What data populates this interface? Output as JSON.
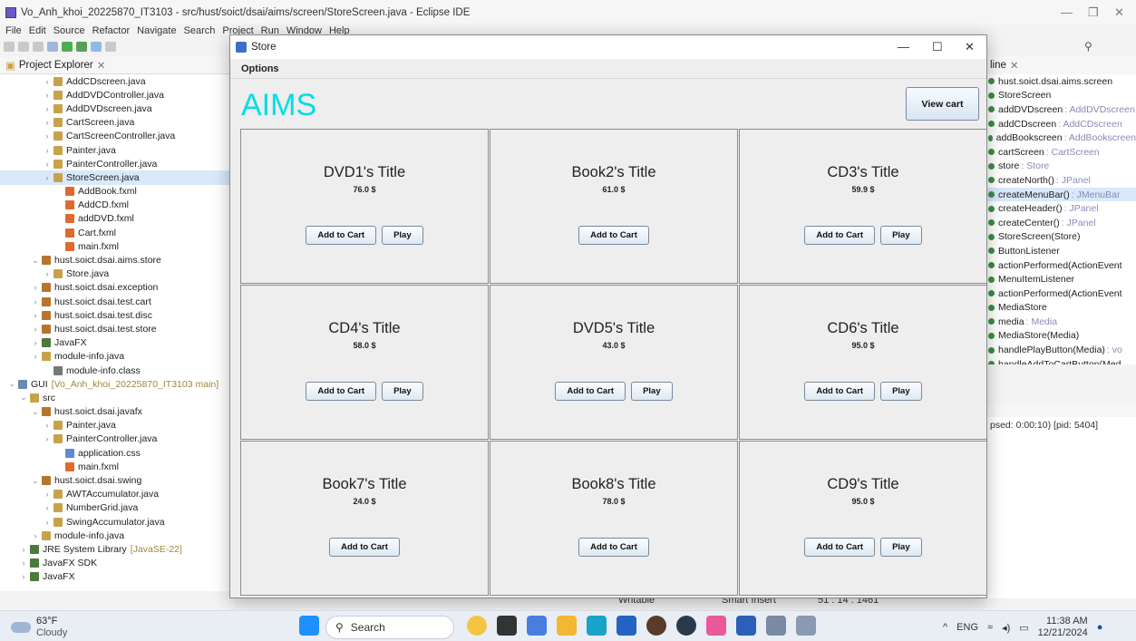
{
  "eclipse": {
    "title": "Vo_Anh_khoi_20225870_IT3103 - src/hust/soict/dsai/aims/screen/StoreScreen.java - Eclipse IDE",
    "menus": [
      "File",
      "Edit",
      "Source",
      "Refactor",
      "Navigate",
      "Search",
      "Project",
      "Run",
      "Window",
      "Help"
    ],
    "project_explorer_title": "Project Explorer",
    "tree": [
      {
        "label": "AddCDscreen.java",
        "indent": 3,
        "kind": "java"
      },
      {
        "label": "AddDVDController.java",
        "indent": 3,
        "kind": "java"
      },
      {
        "label": "AddDVDscreen.java",
        "indent": 3,
        "kind": "java"
      },
      {
        "label": "CartScreen.java",
        "indent": 3,
        "kind": "java"
      },
      {
        "label": "CartScreenController.java",
        "indent": 3,
        "kind": "java"
      },
      {
        "label": "Painter.java",
        "indent": 3,
        "kind": "java"
      },
      {
        "label": "PainterController.java",
        "indent": 3,
        "kind": "java"
      },
      {
        "label": "StoreScreen.java",
        "indent": 3,
        "kind": "java",
        "selected": true
      },
      {
        "label": "AddBook.fxml",
        "indent": 4,
        "kind": "fxml"
      },
      {
        "label": "AddCD.fxml",
        "indent": 4,
        "kind": "fxml"
      },
      {
        "label": "addDVD.fxml",
        "indent": 4,
        "kind": "fxml"
      },
      {
        "label": "Cart.fxml",
        "indent": 4,
        "kind": "fxml"
      },
      {
        "label": "main.fxml",
        "indent": 4,
        "kind": "fxml"
      },
      {
        "label": "hust.soict.dsai.aims.store",
        "indent": 2,
        "kind": "pkg",
        "open": true
      },
      {
        "label": "Store.java",
        "indent": 3,
        "kind": "java"
      },
      {
        "label": "hust.soict.dsai.exception",
        "indent": 2,
        "kind": "pkg"
      },
      {
        "label": "hust.soict.dsai.test.cart",
        "indent": 2,
        "kind": "pkg"
      },
      {
        "label": "hust.soict.dsai.test.disc",
        "indent": 2,
        "kind": "pkg"
      },
      {
        "label": "hust.soict.dsai.test.store",
        "indent": 2,
        "kind": "pkg"
      },
      {
        "label": "JavaFX",
        "indent": 2,
        "kind": "lib"
      },
      {
        "label": "module-info.java",
        "indent": 2,
        "kind": "java"
      },
      {
        "label": "module-info.class",
        "indent": 3,
        "kind": "class"
      },
      {
        "label": "GUI",
        "deco": "[Vo_Anh_khoi_20225870_IT3103 main]",
        "indent": 0,
        "kind": "project",
        "open": true
      },
      {
        "label": "src",
        "indent": 1,
        "kind": "src",
        "open": true
      },
      {
        "label": "hust.soict.dsai.javafx",
        "indent": 2,
        "kind": "pkg",
        "open": true
      },
      {
        "label": "Painter.java",
        "indent": 3,
        "kind": "java"
      },
      {
        "label": "PainterController.java",
        "indent": 3,
        "kind": "java"
      },
      {
        "label": "application.css",
        "indent": 4,
        "kind": "css"
      },
      {
        "label": "main.fxml",
        "indent": 4,
        "kind": "fxml"
      },
      {
        "label": "hust.soict.dsai.swing",
        "indent": 2,
        "kind": "pkg",
        "open": true
      },
      {
        "label": "AWTAccumulator.java",
        "indent": 3,
        "kind": "java"
      },
      {
        "label": "NumberGrid.java",
        "indent": 3,
        "kind": "java"
      },
      {
        "label": "SwingAccumulator.java",
        "indent": 3,
        "kind": "java"
      },
      {
        "label": "module-info.java",
        "indent": 2,
        "kind": "java"
      },
      {
        "label": "JRE System Library",
        "deco": "[JavaSE-22]",
        "indent": 1,
        "kind": "lib"
      },
      {
        "label": "JavaFX SDK",
        "indent": 1,
        "kind": "lib"
      },
      {
        "label": "JavaFX",
        "indent": 1,
        "kind": "lib"
      }
    ],
    "outline_title": "line",
    "outline": [
      {
        "label": "hust.soict.dsai.aims.screen",
        "type": ""
      },
      {
        "label": "StoreScreen",
        "type": ""
      },
      {
        "label": "addDVDscreen",
        "type": ": AddDVDscreen"
      },
      {
        "label": "addCDscreen",
        "type": ": AddCDscreen"
      },
      {
        "label": "addBookscreen",
        "type": ": AddBookscreen"
      },
      {
        "label": "cartScreen",
        "type": ": CartScreen"
      },
      {
        "label": "store",
        "type": ": Store"
      },
      {
        "label": "createNorth()",
        "type": ": JPanel"
      },
      {
        "label": "createMenuBar()",
        "type": ": JMenuBar",
        "selected": true
      },
      {
        "label": "createHeader()",
        "type": ": JPanel"
      },
      {
        "label": "createCenter()",
        "type": ": JPanel"
      },
      {
        "label": "StoreScreen(Store)",
        "type": ""
      },
      {
        "label": "ButtonListener",
        "type": ""
      },
      {
        "label": "actionPerformed(ActionEvent",
        "type": ""
      },
      {
        "label": "MenuItemListener",
        "type": ""
      },
      {
        "label": "actionPerformed(ActionEvent",
        "type": ""
      },
      {
        "label": "MediaStore",
        "type": ""
      },
      {
        "label": "media",
        "type": ": Media"
      },
      {
        "label": "MediaStore(Media)",
        "type": ""
      },
      {
        "label": "handlePlayButton(Media)",
        "type": ": vo"
      },
      {
        "label": "handleAddToCartButton(Med",
        "type": ""
      },
      {
        "label": "main(String[])",
        "type": ": void"
      }
    ],
    "console_text": "psed: 0:00:10) [pid: 5404]",
    "status": {
      "writable": "Writable",
      "insert": "Smart Insert",
      "position": "51 : 14 : 1461"
    }
  },
  "store": {
    "window_title": "Store",
    "menu": "Options",
    "header": "AIMS",
    "view_cart": "View cart",
    "items": [
      {
        "title": "DVD1's Title",
        "price": "76.0 $",
        "add": "Add to Cart",
        "play": "Play"
      },
      {
        "title": "Book2's Title",
        "price": "61.0 $",
        "add": "Add to Cart",
        "play": null
      },
      {
        "title": "CD3's Title",
        "price": "59.9 $",
        "add": "Add to Cart",
        "play": "Play"
      },
      {
        "title": "CD4's Title",
        "price": "58.0 $",
        "add": "Add to Cart",
        "play": "Play"
      },
      {
        "title": "DVD5's Title",
        "price": "43.0 $",
        "add": "Add to Cart",
        "play": "Play"
      },
      {
        "title": "CD6's Title",
        "price": "95.0 $",
        "add": "Add to Cart",
        "play": "Play"
      },
      {
        "title": "Book7's Title",
        "price": "24.0 $",
        "add": "Add to Cart",
        "play": null
      },
      {
        "title": "Book8's Title",
        "price": "78.0 $",
        "add": "Add to Cart",
        "play": null
      },
      {
        "title": "CD9's Title",
        "price": "95.0 $",
        "add": "Add to Cart",
        "play": "Play"
      }
    ]
  },
  "taskbar": {
    "temp": "63°F",
    "weather": "Cloudy",
    "search": "Search",
    "lang": "ENG",
    "time": "11:38 AM",
    "date": "12/21/2024"
  },
  "colors": {
    "aims": "#00dde8",
    "java_icon": "#c8a24a",
    "pkg_icon": "#b8742e",
    "fxml_icon": "#e06a2e",
    "lib_icon": "#4c7a3a"
  }
}
